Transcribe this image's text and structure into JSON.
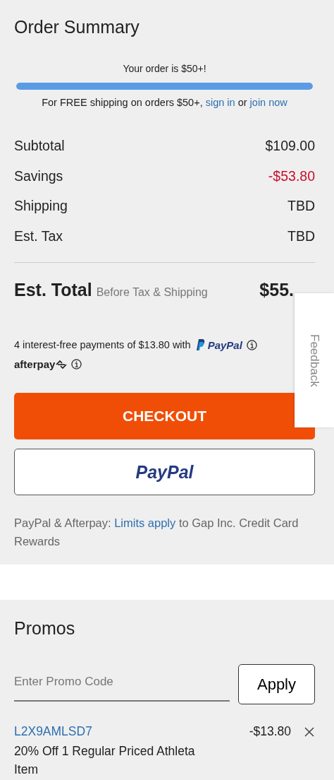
{
  "summary": {
    "title": "Order Summary",
    "progress": {
      "headline": "Your order is $50+!",
      "level": 1
    },
    "shipping_note": {
      "before": "For FREE shipping on orders $50+,",
      "link_1": "sign in",
      "middle": "or",
      "link_2": "join now"
    },
    "rows": [
      {
        "label": "Subtotal",
        "value": "$109.00",
        "color": "#222222"
      },
      {
        "label": "Savings",
        "value": "-$53.80",
        "color": "#c8102e"
      },
      {
        "label": "Shipping",
        "value": "TBD",
        "color": "#222222"
      },
      {
        "label": "Est. Tax",
        "value": "TBD",
        "color": "#222222"
      }
    ],
    "total": {
      "label": "Est. Total",
      "note": "Before Tax & Shipping",
      "value": "$55."
    },
    "installments": {
      "text": "4 interest-free payments of $13.80 with",
      "paypal": "PayPal",
      "afterpay": "afterpay"
    },
    "checkout_button": "CHECKOUT",
    "paypal_button": "PayPal",
    "disclaimer": {
      "before": "PayPal & Afterpay:",
      "link": "Limits apply",
      "after": "to Gap Inc. Credit Card Rewards"
    }
  },
  "feedback_tab": "Feedback",
  "promos": {
    "title": "Promos",
    "field": {
      "placeholder": "Enter Promo Code"
    },
    "apply_button": "Apply",
    "applied": [
      {
        "code": "L2X9AMLSD7",
        "amount": "-$13.80",
        "description": "20% Off 1 Regular Priced Athleta Item"
      }
    ]
  }
}
